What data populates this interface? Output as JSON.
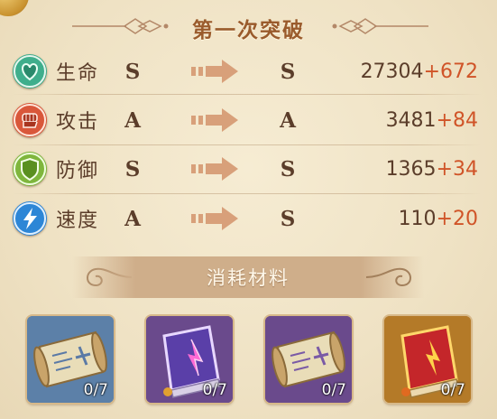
{
  "title": "第一次突破",
  "stats": [
    {
      "label": "生命",
      "icon": "heart-icon",
      "from": "S",
      "to": "S",
      "base": "27304",
      "bonus": "+672",
      "color": "#3fae8c"
    },
    {
      "label": "攻击",
      "icon": "fist-icon",
      "from": "A",
      "to": "A",
      "base": "3481",
      "bonus": "+84",
      "color": "#d9573a"
    },
    {
      "label": "防御",
      "icon": "shield-icon",
      "from": "S",
      "to": "S",
      "base": "1365",
      "bonus": "+34",
      "color": "#7fb63d"
    },
    {
      "label": "速度",
      "icon": "lightning-icon",
      "from": "A",
      "to": "S",
      "base": "110",
      "bonus": "+20",
      "color": "#2d86d6"
    }
  ],
  "materials_title": "消耗材料",
  "materials": [
    {
      "name": "scroll-blue",
      "count": "0/7",
      "bg": "#5c80a8"
    },
    {
      "name": "book-purple",
      "count": "0/7",
      "bg": "#6a4a8c"
    },
    {
      "name": "scroll-purple",
      "count": "0/7",
      "bg": "#6a4a8c"
    },
    {
      "name": "book-red",
      "count": "0/7",
      "bg": "#b47a28"
    }
  ],
  "colors": {
    "bonus": "#d05428",
    "text": "#5b3d2a",
    "title": "#9a5b2c"
  }
}
